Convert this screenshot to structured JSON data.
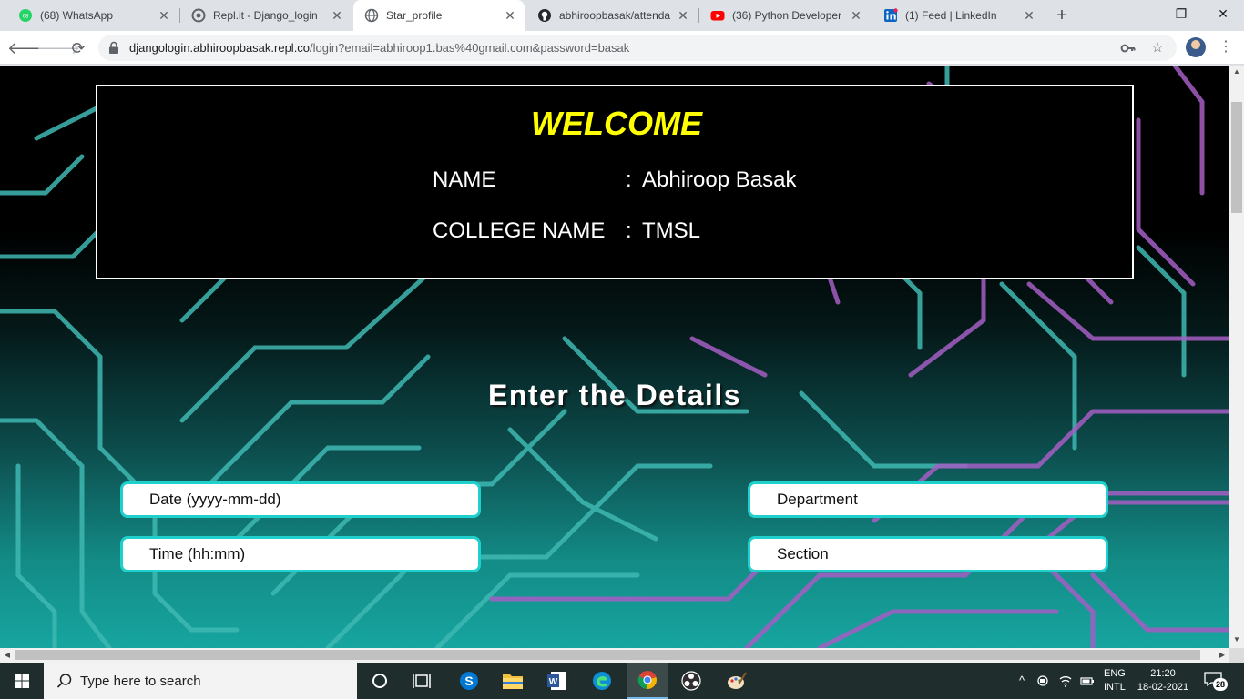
{
  "browser": {
    "tabs": [
      {
        "title": "(68) WhatsApp",
        "favicon": "whatsapp-icon",
        "badge": "68"
      },
      {
        "title": "Repl.it - Django_login",
        "favicon": "replit-icon"
      },
      {
        "title": "Star_profile",
        "favicon": "globe-icon",
        "active": true
      },
      {
        "title": "abhiroopbasak/attenda",
        "favicon": "github-icon"
      },
      {
        "title": "(36) Python Developer",
        "favicon": "youtube-icon"
      },
      {
        "title": "(1) Feed | LinkedIn",
        "favicon": "linkedin-icon"
      }
    ],
    "url_host": "djangologin.abhiroopbasak.repl.co",
    "url_path": "/login?email=abhiroop1.bas%40gmail.com&password=basak"
  },
  "page": {
    "welcome": "WELCOME",
    "name_label": "NAME",
    "name_value": "Abhiroop Basak",
    "college_label": "COLLEGE NAME",
    "college_value": "TMSL",
    "separator": ":",
    "details_heading": "Enter the Details",
    "fields": {
      "date_placeholder": "Date (yyyy-mm-dd)",
      "time_placeholder": "Time (hh:mm)",
      "department_placeholder": "Department",
      "section_placeholder": "Section"
    }
  },
  "taskbar": {
    "search_placeholder": "Type here to search",
    "lang_line1": "ENG",
    "lang_line2": "INTL",
    "time": "21:20",
    "date": "18-02-2021",
    "notification_count": "28"
  },
  "colors": {
    "welcome": "#ffff00",
    "field_border": "#20d0cc",
    "teal_trace": "#3fb8b2",
    "purple_trace": "#a45ec4"
  }
}
